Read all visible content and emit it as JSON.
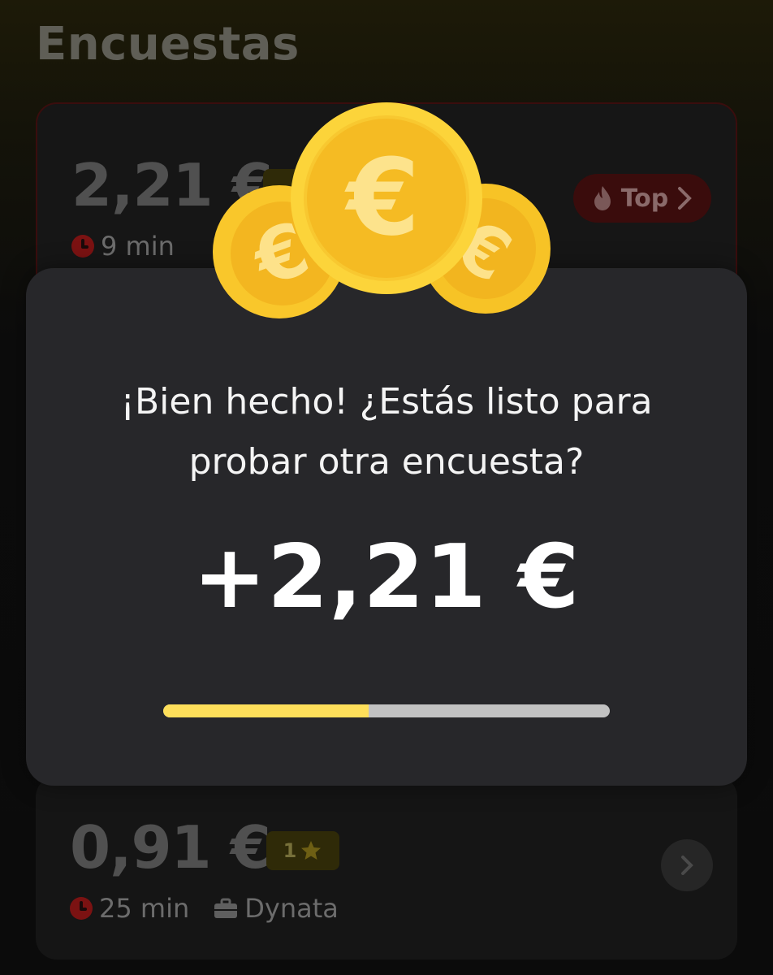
{
  "header": {
    "title": "Encuestas"
  },
  "surveys": [
    {
      "price": "2,21 €",
      "stars": "",
      "duration": "9 min",
      "provider": "",
      "badge": "Top",
      "highlight": true
    },
    {
      "price": "0,91 €",
      "stars": "1",
      "duration": "25 min",
      "provider": "Dynata",
      "highlight": false
    }
  ],
  "modal": {
    "message_line1": "¡Bien hecho! ¿Estás listo para",
    "message_line2": "probar otra encuesta?",
    "reward": "+2,21 €",
    "progress_fraction": 0.46
  },
  "colors": {
    "accent_yellow": "#fedf5a",
    "coin_gold": "#f8c72a",
    "modal_bg": "#27272a",
    "top_badge_bg": "#3a0c0c"
  },
  "icons": [
    "clock-icon",
    "briefcase-icon",
    "star-icon",
    "flame-icon",
    "chevron-right-icon",
    "euro-coin-icon"
  ]
}
